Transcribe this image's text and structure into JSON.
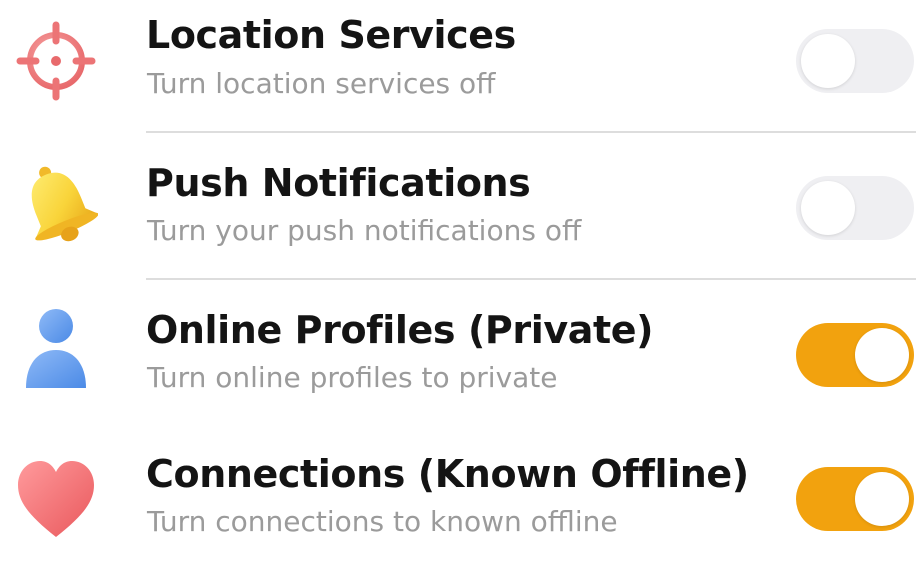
{
  "settings": [
    {
      "title": "Location Services",
      "subtitle": "Turn location services off",
      "icon": "crosshair-icon",
      "enabled": false
    },
    {
      "title": "Push Notifications",
      "subtitle": "Turn your push notifications off",
      "icon": "bell-icon",
      "enabled": false
    },
    {
      "title": "Online Profiles (Private)",
      "subtitle": "Turn online profiles to private",
      "icon": "user-icon",
      "enabled": true
    },
    {
      "title": "Connections (Known Offline)",
      "subtitle": "Turn connections to known offline",
      "icon": "heart-icon",
      "enabled": true
    }
  ],
  "colors": {
    "title": "#141414",
    "subtitle": "#9b9b9b",
    "toggle_on": "#f2a20e",
    "toggle_off": "#efeff2",
    "divider": "#dddddd"
  }
}
